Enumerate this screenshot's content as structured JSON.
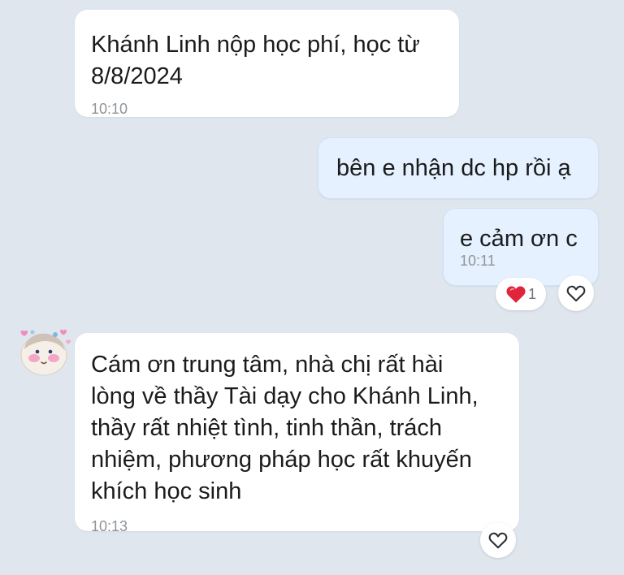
{
  "colors": {
    "background": "#dfe6ee",
    "incoming_bubble": "#ffffff",
    "outgoing_bubble": "#e5f1fe",
    "timestamp": "#8f959b",
    "reaction_heart": "#e0243a"
  },
  "messages": [
    {
      "direction": "incoming",
      "text": "Khánh Linh nộp học phí, học từ\n8/8/2024",
      "time": "10:10"
    },
    {
      "direction": "outgoing",
      "text": "bên e nhận dc hp rồi ạ"
    },
    {
      "direction": "outgoing",
      "text": "e cảm ơn c",
      "time": "10:11",
      "reactions": [
        {
          "icon": "red-heart-icon",
          "count": "1"
        },
        {
          "icon": "heart-outline-icon"
        }
      ]
    },
    {
      "direction": "incoming",
      "sender_avatar": "cartoon-avatar-icon",
      "text": "Cám ơn trung tâm, nhà chị rất hài\nlòng về thầy Tài dạy cho Khánh Linh,\nthầy rất nhiệt tình, tinh thần, trách\nnhiệm, phương pháp học rất khuyến\nkhích học sinh",
      "time": "10:13",
      "reactions": [
        {
          "icon": "heart-outline-icon"
        }
      ]
    }
  ]
}
